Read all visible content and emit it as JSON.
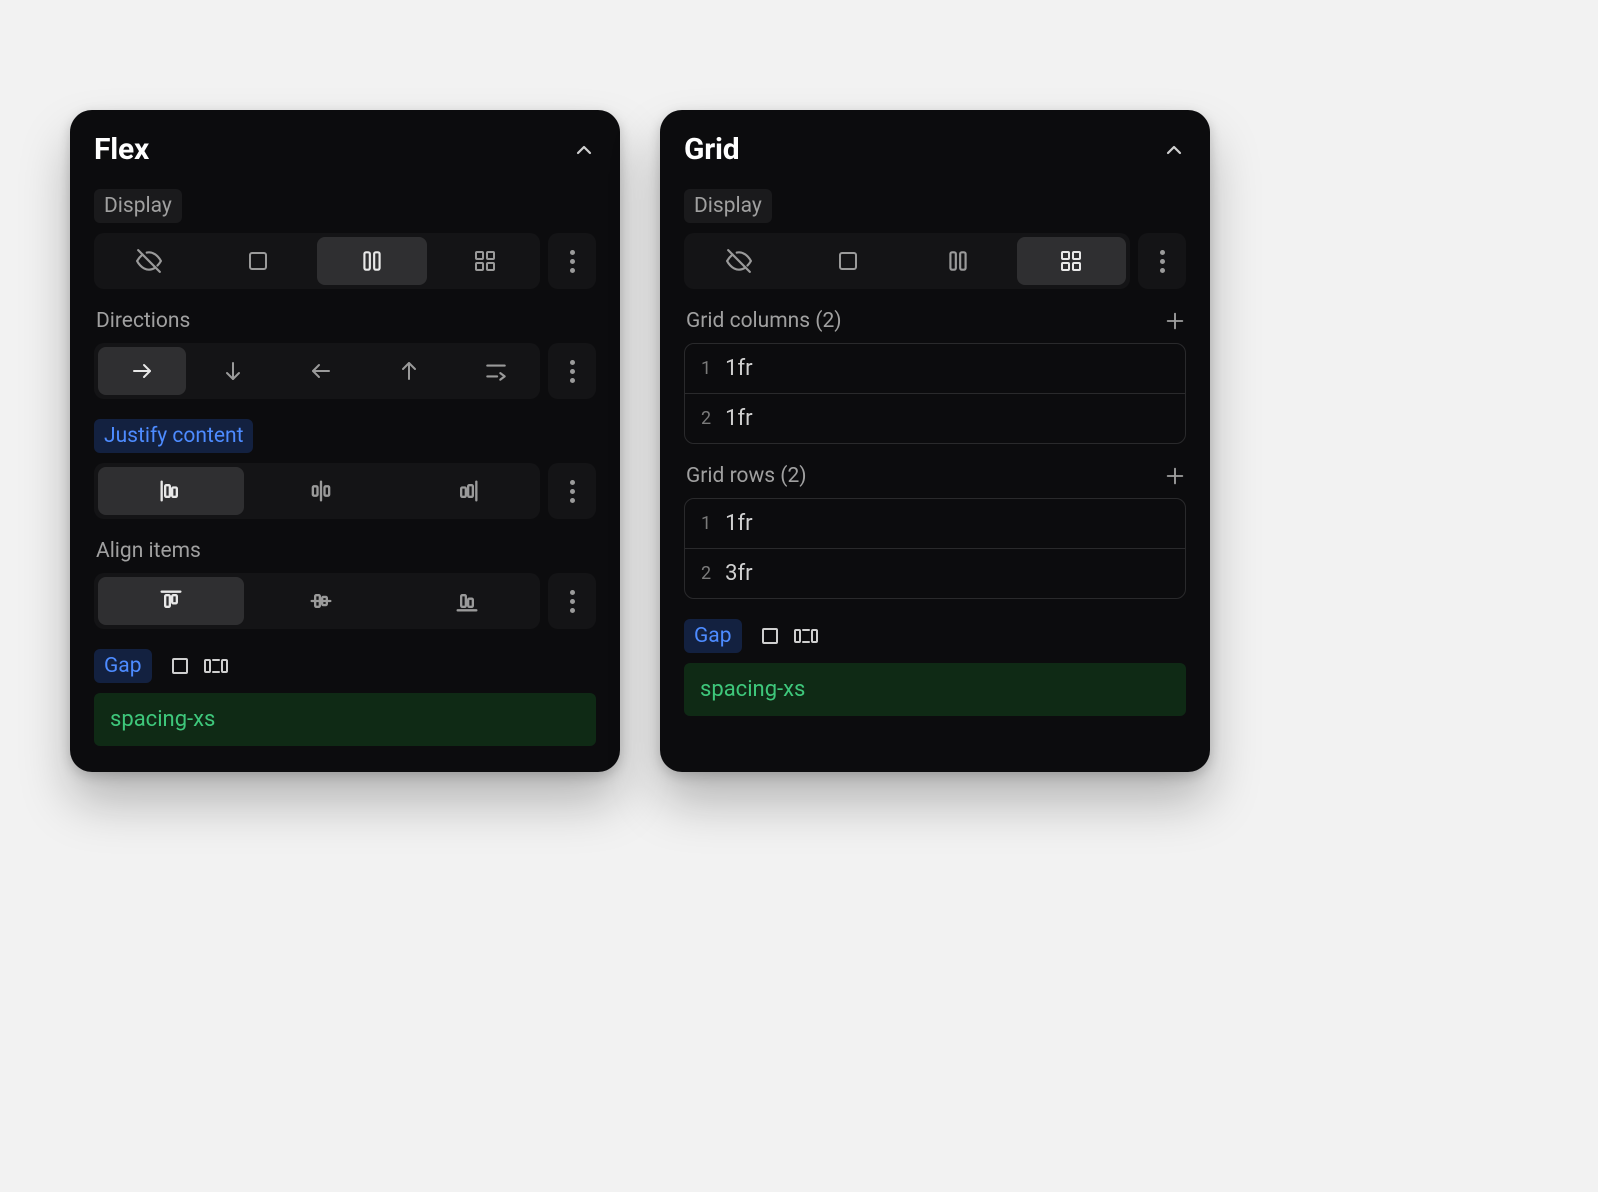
{
  "flex": {
    "title": "Flex",
    "display_label": "Display",
    "directions_label": "Directions",
    "justify_label": "Justify content",
    "align_label": "Align items",
    "gap_label": "Gap",
    "gap_value": "spacing-xs",
    "display_active": "flex",
    "direction_active": "row",
    "justify_active": "start",
    "align_active": "start"
  },
  "grid": {
    "title": "Grid",
    "display_label": "Display",
    "display_active": "grid",
    "grid_columns_label": "Grid columns (2)",
    "grid_rows_label": "Grid rows (2)",
    "columns": [
      {
        "index": "1",
        "value": "1fr"
      },
      {
        "index": "2",
        "value": "1fr"
      }
    ],
    "rows": [
      {
        "index": "1",
        "value": "1fr"
      },
      {
        "index": "2",
        "value": "3fr"
      }
    ],
    "gap_label": "Gap",
    "gap_value": "spacing-xs"
  }
}
